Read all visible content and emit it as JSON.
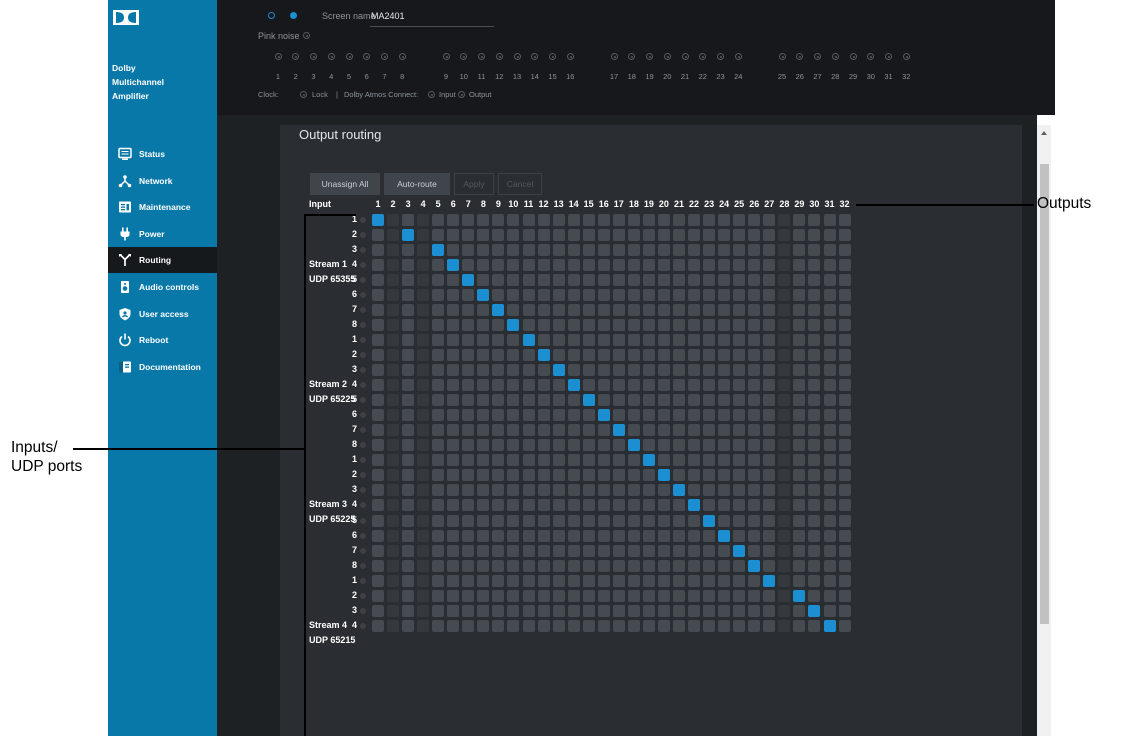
{
  "sidebar": {
    "app_name_lines": [
      "Dolby",
      "Multichannel",
      "Amplifier"
    ],
    "items": [
      {
        "label": "Status",
        "icon": "monitor-icon",
        "active": false
      },
      {
        "label": "Network",
        "icon": "network-icon",
        "active": false
      },
      {
        "label": "Maintenance",
        "icon": "maintenance-icon",
        "active": false
      },
      {
        "label": "Power",
        "icon": "plug-icon",
        "active": false
      },
      {
        "label": "Routing",
        "icon": "routing-icon",
        "active": true
      },
      {
        "label": "Audio controls",
        "icon": "speaker-icon",
        "active": false
      },
      {
        "label": "User access",
        "icon": "shield-icon",
        "active": false
      },
      {
        "label": "Reboot",
        "icon": "power-icon",
        "active": false
      },
      {
        "label": "Documentation",
        "icon": "document-icon",
        "active": false
      }
    ]
  },
  "header": {
    "screen_name_label": "Screen name",
    "screen_name_value": "MA2401",
    "pink_noise_label": "Pink noise",
    "channel_numbers": [
      "1",
      "2",
      "3",
      "4",
      "5",
      "6",
      "7",
      "8",
      "9",
      "10",
      "11",
      "12",
      "13",
      "14",
      "15",
      "16",
      "17",
      "18",
      "19",
      "20",
      "21",
      "22",
      "23",
      "24",
      "25",
      "26",
      "27",
      "28",
      "29",
      "30",
      "31",
      "32"
    ],
    "clock_label": "Clock:",
    "lock_label": "Lock",
    "separator": "|",
    "atmos_label": "Dolby Atmos Connect:",
    "input_label": "Input",
    "output_label": "Output"
  },
  "routing": {
    "title": "Output routing",
    "buttons": {
      "unassign_all": "Unassign All",
      "auto_route": "Auto-route",
      "apply": "Apply",
      "cancel": "Cancel"
    },
    "input_header": "Input",
    "output_numbers": [
      "1",
      "2",
      "3",
      "4",
      "5",
      "6",
      "7",
      "8",
      "9",
      "10",
      "11",
      "12",
      "13",
      "14",
      "15",
      "16",
      "17",
      "18",
      "19",
      "20",
      "21",
      "22",
      "23",
      "24",
      "25",
      "26",
      "27",
      "28",
      "29",
      "30",
      "31",
      "32"
    ],
    "streams": [
      {
        "name": "Stream 1",
        "port": "UDP 65355",
        "inputs": [
          "1",
          "2",
          "3",
          "4",
          "5",
          "6",
          "7",
          "8"
        ]
      },
      {
        "name": "Stream 2",
        "port": "UDP 65225",
        "inputs": [
          "1",
          "2",
          "3",
          "4",
          "5",
          "6",
          "7",
          "8"
        ]
      },
      {
        "name": "Stream 3",
        "port": "UDP 65225",
        "inputs": [
          "1",
          "2",
          "3",
          "4",
          "5",
          "6",
          "7",
          "8"
        ]
      },
      {
        "name": "Stream 4",
        "port": "UDP 65215",
        "inputs": [
          "1",
          "2",
          "3",
          "4"
        ]
      }
    ],
    "assigned_output_per_row": [
      1,
      3,
      5,
      6,
      7,
      8,
      9,
      10,
      11,
      12,
      13,
      14,
      15,
      16,
      17,
      18,
      19,
      20,
      21,
      22,
      23,
      24,
      25,
      26,
      27,
      29,
      30,
      31
    ]
  },
  "callouts": {
    "outputs": "Outputs",
    "inputs_line1": "Inputs/",
    "inputs_line2": "UDP ports"
  },
  "colors": {
    "sidebar": "#0878a8",
    "assigned": "#1b8fd1",
    "cell": "#454b51"
  }
}
